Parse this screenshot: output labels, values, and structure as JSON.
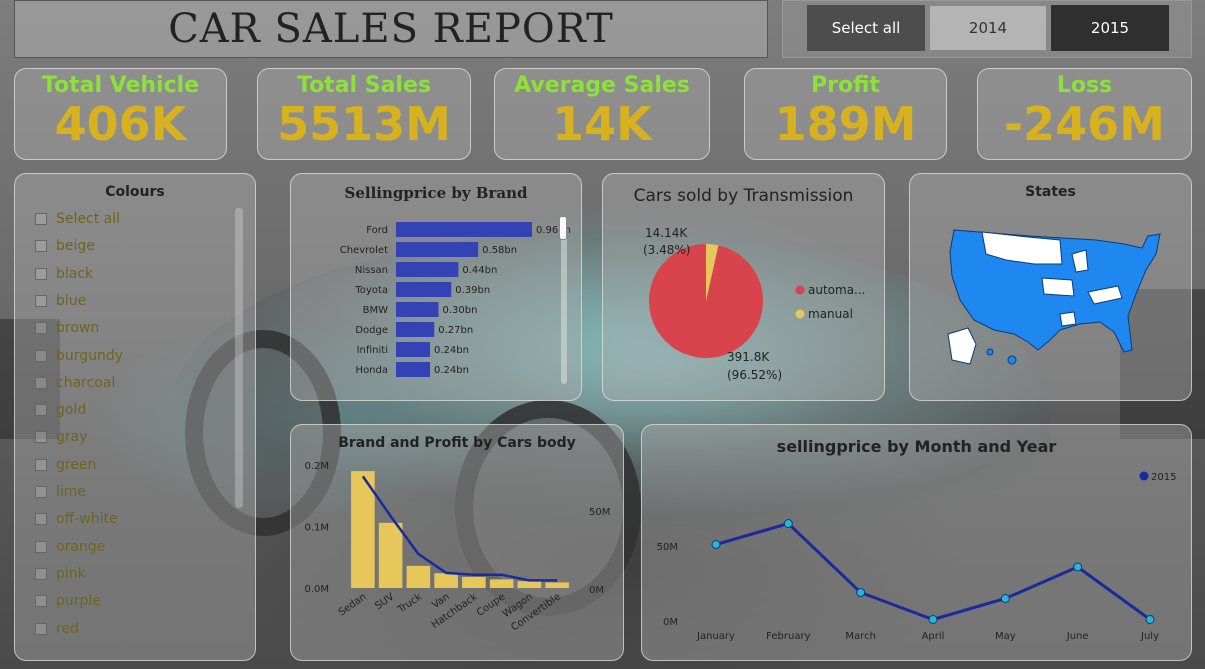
{
  "header": {
    "title": "CAR SALES REPORT"
  },
  "year_filter": {
    "options": [
      "Select all",
      "2014",
      "2015"
    ],
    "selected": "2015"
  },
  "kpis": [
    {
      "label": "Total Vehicle",
      "value": "406K"
    },
    {
      "label": "Total Sales",
      "value": "5513M"
    },
    {
      "label": "Average Sales",
      "value": "14K"
    },
    {
      "label": "Profit",
      "value": "189M"
    },
    {
      "label": "Loss",
      "value": "-246M"
    }
  ],
  "colours": {
    "title": "Colours",
    "items": [
      "Select all",
      "beige",
      "black",
      "blue",
      "brown",
      "burgundy",
      "charcoal",
      "gold",
      "gray",
      "green",
      "lime",
      "off-white",
      "orange",
      "pink",
      "purple",
      "red"
    ]
  },
  "colors": {
    "kpi_label": "#8ee03a",
    "kpi_value": "#d7b21e",
    "bar_blue": "#3343b5",
    "pie_red": "#d9434e",
    "pie_yellow": "#e8c75a",
    "line_navy": "#1a2a9a",
    "state_blue": "#1e88f0"
  },
  "chart_data": [
    {
      "type": "bar",
      "title": "Sellingprice by Brand",
      "orientation": "horizontal",
      "categories": [
        "Ford",
        "Chevrolet",
        "Nissan",
        "Toyota",
        "BMW",
        "Dodge",
        "Infiniti",
        "Honda"
      ],
      "values": [
        0.96,
        0.58,
        0.44,
        0.39,
        0.3,
        0.27,
        0.24,
        0.24
      ],
      "data_labels": [
        "0.96bn",
        "0.58bn",
        "0.44bn",
        "0.39bn",
        "0.30bn",
        "0.27bn",
        "0.24bn",
        "0.24bn"
      ]
    },
    {
      "type": "pie",
      "title": "Cars sold by Transmission",
      "labels": [
        "automa...",
        "manual"
      ],
      "values": [
        391800,
        14140
      ],
      "data_labels": [
        "391.8K",
        "(96.52%)",
        "14.14K",
        "(3.48%)"
      ],
      "legend_position": "right"
    },
    {
      "type": "bar",
      "title": "Brand and Profit by Cars body",
      "categories": [
        "Sedan",
        "SUV",
        "Truck",
        "Van",
        "Hatchback",
        "Coupe",
        "Wagon",
        "Convertible"
      ],
      "series": [
        {
          "type": "bar",
          "values": [
            0.19,
            0.106,
            0.036,
            0.024,
            0.018,
            0.014,
            0.011,
            0.009
          ]
        },
        {
          "type": "line",
          "values": [
            59,
            38,
            18,
            8,
            7,
            7,
            4,
            4
          ]
        }
      ],
      "y_ticks": [
        "0.2M",
        "0.1M",
        "0.0M"
      ],
      "y2_ticks": [
        "50M",
        "0M"
      ],
      "ylim": [
        0,
        0.2
      ],
      "y2lim": [
        0,
        65
      ]
    },
    {
      "type": "line",
      "title": "sellingprice by Month and Year",
      "categories": [
        "January",
        "February",
        "March",
        "April",
        "May",
        "June",
        "July"
      ],
      "series": [
        {
          "name": "2015",
          "values": [
            51,
            65,
            19,
            1,
            15,
            36,
            1
          ]
        }
      ],
      "y_ticks": [
        "50M",
        "0M"
      ],
      "ylim": [
        0,
        80
      ],
      "legend_position": "top-right"
    }
  ],
  "states": {
    "title": "States"
  }
}
